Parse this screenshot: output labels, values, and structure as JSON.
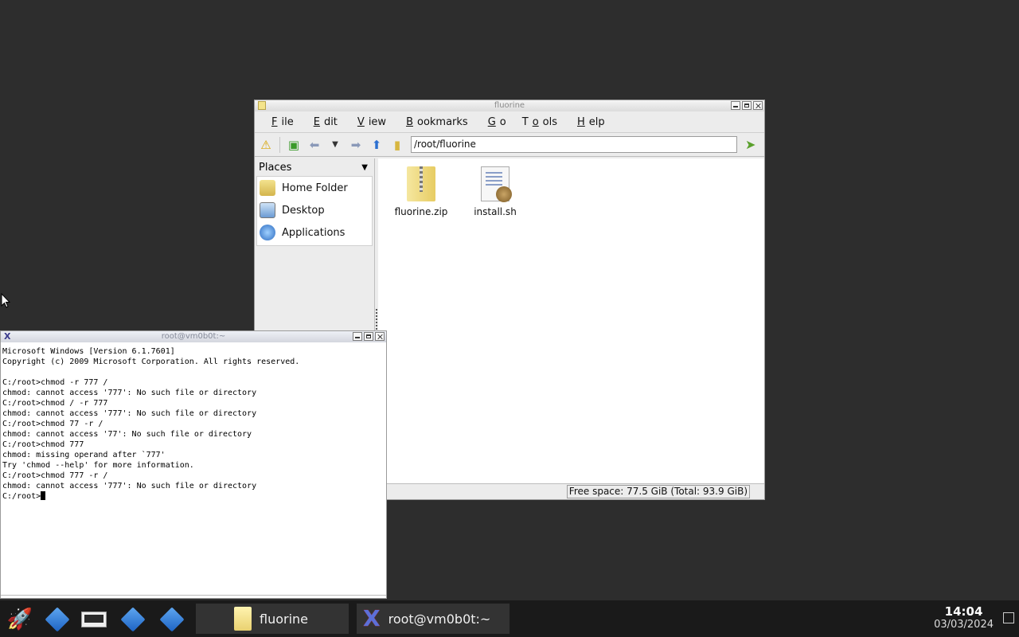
{
  "file_manager": {
    "title": "fluorine",
    "menu": [
      {
        "pre": "",
        "key": "F",
        "post": "ile"
      },
      {
        "pre": "",
        "key": "E",
        "post": "dit"
      },
      {
        "pre": "",
        "key": "V",
        "post": "iew"
      },
      {
        "pre": "",
        "key": "B",
        "post": "ookmarks"
      },
      {
        "pre": "",
        "key": "G",
        "post": "o"
      },
      {
        "pre": "T",
        "key": "o",
        "post": "ols"
      },
      {
        "pre": "",
        "key": "H",
        "post": "elp"
      }
    ],
    "location": "/root/fluorine",
    "sidebar": {
      "header": "Places",
      "items": [
        {
          "label": "Home Folder",
          "icon": "home-folder-icon"
        },
        {
          "label": "Desktop",
          "icon": "desktop-icon"
        },
        {
          "label": "Applications",
          "icon": "applications-icon"
        }
      ]
    },
    "files": [
      {
        "name": "fluorine.zip",
        "icon": "zip-archive-icon"
      },
      {
        "name": "install.sh",
        "icon": "shell-script-icon"
      }
    ],
    "status": "Free space: 77.5 GiB (Total: 93.9 GiB)"
  },
  "terminal": {
    "title": "root@vm0b0t:~",
    "lines": [
      "Microsoft Windows [Version 6.1.7601]",
      "Copyright (c) 2009 Microsoft Corporation. All rights reserved.",
      "",
      "C:/root>chmod -r 777 /",
      "chmod: cannot access '777': No such file or directory",
      "C:/root>chmod / -r 777",
      "chmod: cannot access '777': No such file or directory",
      "C:/root>chmod 77 -r /",
      "chmod: cannot access '77': No such file or directory",
      "C:/root>chmod 777",
      "chmod: missing operand after `777'",
      "Try 'chmod --help' for more information.",
      "C:/root>chmod 777 -r /",
      "chmod: cannot access '777': No such file or directory"
    ],
    "prompt": "C:/root>"
  },
  "taskbar": {
    "tasks": [
      {
        "label": "fluorine"
      },
      {
        "label": "root@vm0b0t:~"
      }
    ],
    "time": "14:04",
    "date": "03/03/2024"
  }
}
